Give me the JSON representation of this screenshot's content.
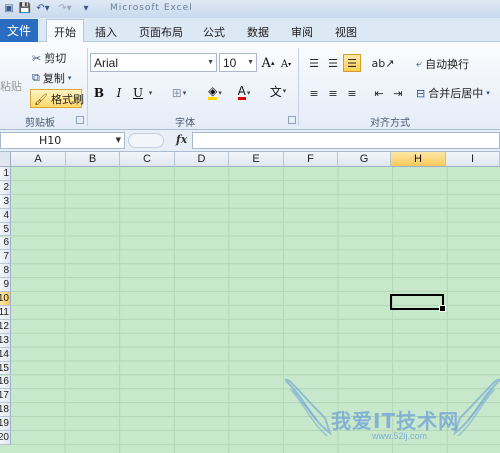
{
  "titlebar": {
    "title": "Microsoft Excel"
  },
  "tabs": {
    "file": "文件",
    "items": [
      "开始",
      "插入",
      "页面布局",
      "公式",
      "数据",
      "审阅",
      "视图"
    ],
    "active": "开始"
  },
  "clipboard": {
    "paste": "粘贴",
    "cut": "剪切",
    "copy": "复制",
    "format_painter": "格式刷",
    "label": "剪贴板"
  },
  "font": {
    "name": "Arial",
    "size": "10",
    "label": "字体",
    "bold": "B",
    "italic": "I",
    "underline": "U",
    "grow": "A",
    "shrink": "A",
    "color": "A",
    "wen": "文"
  },
  "alignment": {
    "wrap": "自动换行",
    "merge": "合并后居中",
    "label": "对齐方式"
  },
  "formula_bar": {
    "name_box": "H10",
    "fx": "fx",
    "value": ""
  },
  "grid": {
    "columns": [
      "A",
      "B",
      "C",
      "D",
      "E",
      "F",
      "G",
      "H",
      "I"
    ],
    "rows": [
      "1",
      "2",
      "3",
      "4",
      "5",
      "6",
      "7",
      "8",
      "9",
      "10",
      "11",
      "12",
      "13",
      "14",
      "15",
      "16",
      "17",
      "18",
      "19",
      "20"
    ],
    "selected_column": "H",
    "selected_row": "10",
    "cell_background": "#c8e8cb"
  },
  "watermark": {
    "text": "我爱IT技术网",
    "url": "www.52ij.com"
  },
  "colors": {
    "file_tab": "#2a6cc1",
    "selection_highlight": "#f7c85a",
    "sheet_green": "#c8e8cb"
  }
}
